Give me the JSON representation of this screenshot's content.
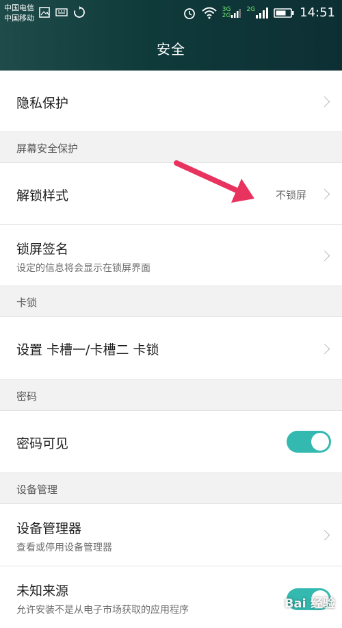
{
  "status_bar": {
    "carrier_1": "中国电信",
    "carrier_2": "中国移动",
    "network_1": "3G",
    "network_2": "2G",
    "network_3": "2G",
    "time": "14:51"
  },
  "header": {
    "title": "安全"
  },
  "items": {
    "privacy": {
      "title": "隐私保护"
    },
    "section_screen": {
      "title": "屏幕安全保护"
    },
    "unlock_style": {
      "title": "解锁样式",
      "value": "不锁屏"
    },
    "lock_signature": {
      "title": "锁屏签名",
      "subtitle": "设定的信息将会显示在锁屏界面"
    },
    "section_card": {
      "title": "卡锁"
    },
    "card_lock": {
      "title": "设置 卡槽一/卡槽二 卡锁"
    },
    "section_password": {
      "title": "密码"
    },
    "password_visible": {
      "title": "密码可见",
      "enabled": true
    },
    "section_device": {
      "title": "设备管理"
    },
    "device_manager": {
      "title": "设备管理器",
      "subtitle": "查看或停用设备管理器"
    },
    "unknown_sources": {
      "title": "未知来源",
      "subtitle": "允许安装不是从电子市场获取的应用程序",
      "enabled": true
    }
  },
  "colors": {
    "header_bg": "#0f3a3a",
    "accent": "#34b9b0",
    "arrow": "#e8335f"
  },
  "watermark": "Bai 经验"
}
